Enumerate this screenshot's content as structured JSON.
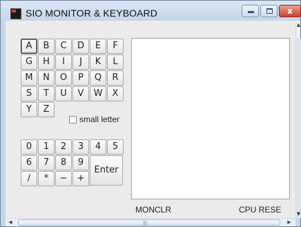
{
  "window": {
    "title": "SIO MONITOR & KEYBOARD",
    "close_glyph": "x",
    "icons": [
      "app-icon",
      "minimize-icon",
      "maximize-icon",
      "close-icon"
    ]
  },
  "keyboard": {
    "letter_rows": [
      [
        "A",
        "B",
        "C",
        "D",
        "E",
        "F"
      ],
      [
        "G",
        "H",
        "I",
        "J",
        "K",
        "L"
      ],
      [
        "M",
        "N",
        "O",
        "P",
        "Q",
        "R"
      ],
      [
        "S",
        "T",
        "U",
        "V",
        "W",
        "X"
      ],
      [
        "Y",
        "Z"
      ]
    ],
    "selected_key": "A",
    "small_letter_label": "small letter",
    "small_letter_checked": false,
    "digit_rows": [
      [
        "0",
        "1",
        "2",
        "3",
        "4",
        "5"
      ],
      [
        "6",
        "7",
        "8",
        "9"
      ],
      [
        "/",
        "*",
        "−",
        "+"
      ]
    ],
    "enter_label": "Enter"
  },
  "monitor": {
    "content": ""
  },
  "bottom": {
    "left_label": "MONCLR",
    "right_label": "CPU RESE"
  },
  "scrollbars": {
    "up_arrow": "▲",
    "down_arrow": "▼",
    "left_arrow": "◀",
    "right_arrow": "▶",
    "grip": "|||"
  },
  "colors": {
    "frame": "#c9d6e8",
    "close_button": "#c9432c",
    "client_bg": "#f2f2f2"
  }
}
